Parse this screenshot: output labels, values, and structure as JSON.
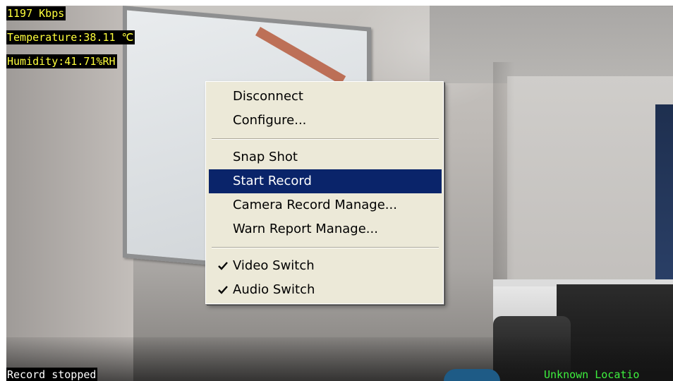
{
  "osd": {
    "bitrate": "1197 Kbps",
    "temperature": "Temperature:38.11 ℃",
    "humidity": "Humidity:41.71%RH",
    "record_status": "Record stopped",
    "location": "Unknown Locatio"
  },
  "context_menu": {
    "items": [
      {
        "label": "Disconnect",
        "checked": false,
        "highlighted": false
      },
      {
        "label": "Configure...",
        "checked": false,
        "highlighted": false
      },
      {
        "label": "Snap Shot",
        "checked": false,
        "highlighted": false
      },
      {
        "label": "Start Record",
        "checked": false,
        "highlighted": true
      },
      {
        "label": "Camera Record Manage...",
        "checked": false,
        "highlighted": false
      },
      {
        "label": "Warn Report Manage...",
        "checked": false,
        "highlighted": false
      },
      {
        "label": "Video Switch",
        "checked": true,
        "highlighted": false
      },
      {
        "label": "Audio Switch",
        "checked": true,
        "highlighted": false
      }
    ],
    "check_icon": "checkmark-icon"
  },
  "colors": {
    "menu_background": "#ece9d8",
    "menu_highlight": "#0a246a",
    "osd_text_yellow": "#ffff3c",
    "osd_location_green": "#3ef03e"
  }
}
